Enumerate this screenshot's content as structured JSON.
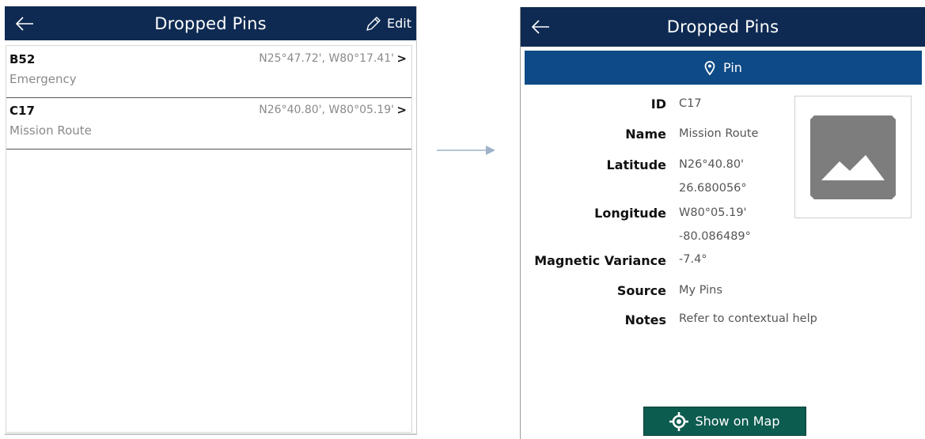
{
  "list_screen": {
    "title": "Dropped Pins",
    "edit_label": "Edit",
    "items": [
      {
        "id": "B52",
        "name": "Emergency",
        "coords": "N25°47.72', W80°17.41'",
        "chevron": ">"
      },
      {
        "id": "C17",
        "name": "Mission Route",
        "coords": "N26°40.80', W80°05.19'",
        "chevron": ">"
      }
    ]
  },
  "detail_screen": {
    "title": "Dropped Pins",
    "tab_label": "Pin",
    "fields": {
      "id": {
        "label": "ID",
        "value": "C17"
      },
      "name": {
        "label": "Name",
        "value": "Mission Route"
      },
      "latitude": {
        "label": "Latitude",
        "value": "N26°40.80'",
        "value_decimal": "26.680056°"
      },
      "longitude": {
        "label": "Longitude",
        "value": "W80°05.19'",
        "value_decimal": "-80.086489°"
      },
      "magnetic_variance": {
        "label": "Magnetic Variance",
        "value": "-7.4°"
      },
      "source": {
        "label": "Source",
        "value": "My Pins"
      },
      "notes": {
        "label": "Notes",
        "value": "Refer to contextual help"
      }
    },
    "show_on_map_label": "Show on Map"
  },
  "icons": {
    "back": "back-arrow-icon",
    "edit": "pencil-icon",
    "tab": "map-pin-icon",
    "placeholder": "image-placeholder-icon",
    "map_button": "locate-target-icon",
    "connector": "right-arrow-icon"
  },
  "colors": {
    "header_navy": "#0e2a52",
    "tab_blue": "#0e4a86",
    "button_green": "#0d5c50"
  }
}
